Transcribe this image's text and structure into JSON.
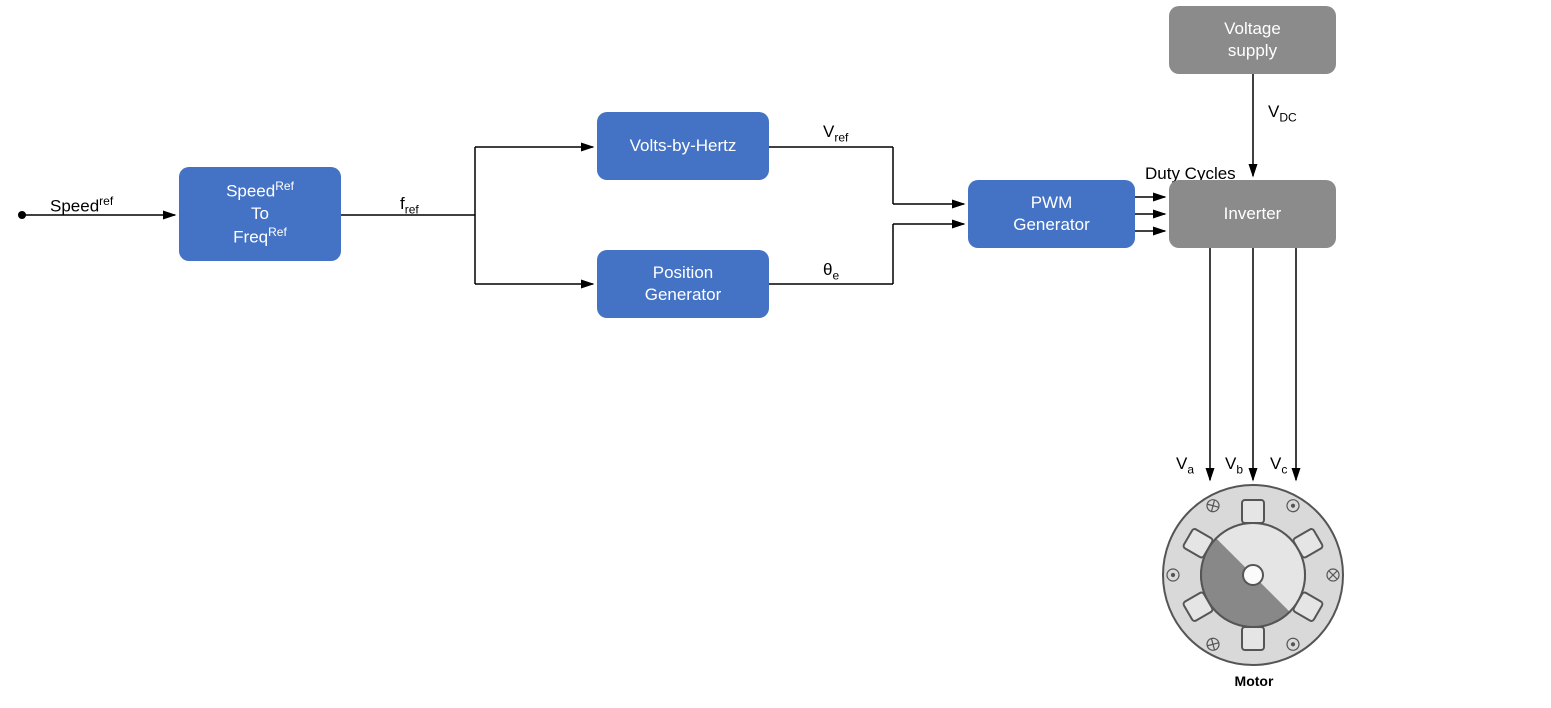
{
  "input_label": {
    "text": "Speed",
    "sup": "ref"
  },
  "blocks": {
    "speed_to_freq": {
      "line1": "Speed",
      "sup1": "Ref",
      "line2": "To",
      "line3": "Freq",
      "sup3": "Ref"
    },
    "volts_by_hertz": "Volts-by-Hertz",
    "position_generator": {
      "line1": "Position",
      "line2": "Generator"
    },
    "pwm_generator": {
      "line1": "PWM",
      "line2": "Generator"
    },
    "voltage_supply": {
      "line1": "Voltage",
      "line2": "supply"
    },
    "inverter": "Inverter"
  },
  "signals": {
    "f_ref": {
      "text": "f",
      "sub": "ref"
    },
    "v_ref": {
      "text": "V",
      "sub": "ref"
    },
    "theta_e": {
      "text": "θ",
      "sub": "e"
    },
    "duty_cycles": "Duty Cycles",
    "v_dc": {
      "text": "V",
      "sub": "DC"
    },
    "v_a": {
      "text": "V",
      "sub": "a"
    },
    "v_b": {
      "text": "V",
      "sub": "b"
    },
    "v_c": {
      "text": "V",
      "sub": "c"
    }
  },
  "motor_label": "Motor"
}
